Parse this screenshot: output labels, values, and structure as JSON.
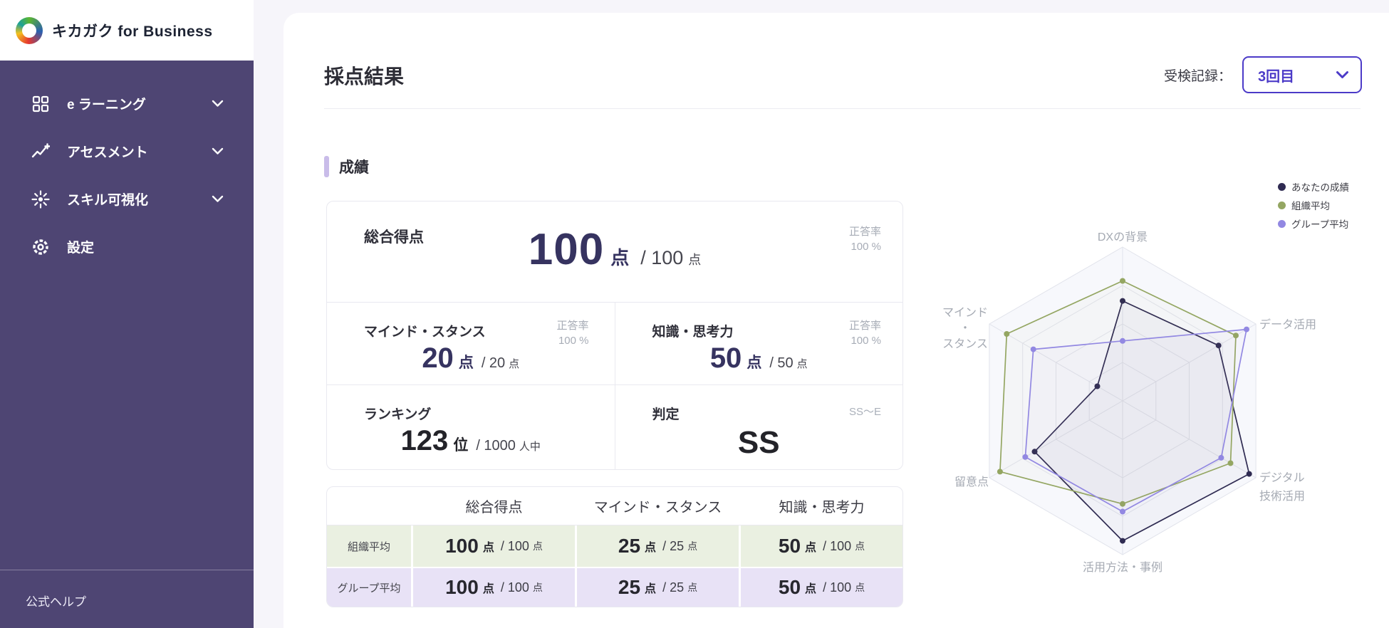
{
  "sidebar": {
    "brand": "キカガク for Business",
    "items": [
      {
        "label": "e ラーニング",
        "icon": "grid-icon",
        "expandable": true
      },
      {
        "label": "アセスメント",
        "icon": "trend-icon",
        "expandable": true
      },
      {
        "label": "スキル可視化",
        "icon": "sparkle-icon",
        "expandable": true
      },
      {
        "label": "設定",
        "icon": "gear-icon",
        "expandable": false
      }
    ],
    "footer_link": "公式ヘルプ"
  },
  "header": {
    "title": "採点結果",
    "record_label": "受検記録：",
    "record_value": "3回目",
    "accent_color": "#4c3bc8"
  },
  "section": {
    "title": "成績"
  },
  "scorecard": {
    "overall": {
      "label": "総合得点",
      "value": "100",
      "unit": "点",
      "max": "/ 100",
      "max_unit": "点",
      "rate_label": "正答率",
      "rate_value": "100 %"
    },
    "mind": {
      "label": "マインド・スタンス",
      "value": "20",
      "unit": "点",
      "max": "/ 20",
      "max_unit": "点",
      "rate_label": "正答率",
      "rate_value": "100 %"
    },
    "knowledge": {
      "label": "知識・思考力",
      "value": "50",
      "unit": "点",
      "max": "/ 50",
      "max_unit": "点",
      "rate_label": "正答率",
      "rate_value": "100 %"
    },
    "ranking": {
      "label": "ランキング",
      "value": "123",
      "unit": "位",
      "max": "/ 1000",
      "max_unit": "人中"
    },
    "grade": {
      "label": "判定",
      "value": "SS",
      "scale": "SS〜E"
    }
  },
  "comparison_table": {
    "headers": [
      "",
      "総合得点",
      "マインド・スタンス",
      "知識・思考力"
    ],
    "rows": [
      {
        "label": "組織平均",
        "row_color": "#eaf0e1",
        "cells": [
          {
            "value": "100",
            "unit": "点",
            "max": "/ 100",
            "max_unit": "点"
          },
          {
            "value": "25",
            "unit": "点",
            "max": "/ 25",
            "max_unit": "点"
          },
          {
            "value": "50",
            "unit": "点",
            "max": "/ 100",
            "max_unit": "点"
          }
        ]
      },
      {
        "label": "グループ平均",
        "row_color": "#e8e2f6",
        "cells": [
          {
            "value": "100",
            "unit": "点",
            "max": "/ 100",
            "max_unit": "点"
          },
          {
            "value": "25",
            "unit": "点",
            "max": "/ 25",
            "max_unit": "点"
          },
          {
            "value": "50",
            "unit": "点",
            "max": "/ 100",
            "max_unit": "点"
          }
        ]
      }
    ]
  },
  "chart_data": {
    "type": "radar",
    "max": 100,
    "rings": 4,
    "grid_color": "#e1e3eb",
    "grid_fill": "#f7f8fc",
    "axes": [
      {
        "label": [
          "DXの背景"
        ]
      },
      {
        "label": [
          "データ活用"
        ]
      },
      {
        "label": [
          "デジタル",
          "技術活用"
        ]
      },
      {
        "label": [
          "活用方法・事例"
        ]
      },
      {
        "label": [
          "留意点"
        ]
      },
      {
        "label": [
          "マインド",
          "・",
          "スタンス"
        ]
      }
    ],
    "series": [
      {
        "name": "あなたの成績",
        "color": "#2f2b52",
        "values": [
          65,
          72,
          95,
          91,
          66,
          19
        ]
      },
      {
        "name": "組織平均",
        "color": "#94a662",
        "values": [
          78,
          85,
          81,
          67,
          92,
          87
        ]
      },
      {
        "name": "グループ平均",
        "color": "#9288e2",
        "values": [
          39,
          93,
          74,
          72,
          73,
          67
        ]
      }
    ],
    "legend_position": "top-right"
  }
}
